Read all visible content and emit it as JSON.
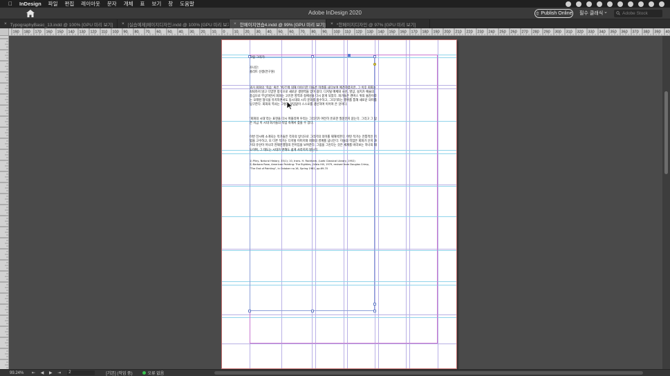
{
  "menubar": {
    "app_name": "InDesign",
    "items": [
      "파일",
      "편집",
      "레이아웃",
      "문자",
      "개체",
      "표",
      "보기",
      "창",
      "도움말"
    ]
  },
  "appbar": {
    "title": "Adobe InDesign 2020",
    "publish_label": "Publish Online",
    "workspace_label": "필수 클래식",
    "search_placeholder": "Adobe Stock"
  },
  "tabs": [
    {
      "label": "TypographyBasic_13.indd @ 100% [GPU 미리 보기]",
      "active": false
    },
    {
      "label": "[실습예제]페이지디자인.indd @ 100% [GPU 미리 보기]",
      "active": false
    },
    {
      "label": "한페이지연습4.indd @ 99% [GPU 미리 보기]",
      "active": true
    },
    {
      "label": "*한페이지디자인 @ 97% [GPU 미리 보기]",
      "active": false
    }
  ],
  "ruler": {
    "h_labels": [
      "190",
      "180",
      "170",
      "160",
      "150",
      "140",
      "130",
      "120",
      "110",
      "100",
      "90",
      "80",
      "70",
      "60",
      "50",
      "40",
      "30",
      "20",
      "10",
      "0",
      "10",
      "20",
      "30",
      "40",
      "50",
      "60",
      "70",
      "80",
      "90",
      "100",
      "110",
      "120",
      "130",
      "140",
      "150",
      "160",
      "170",
      "180",
      "190",
      "200",
      "210",
      "220",
      "230",
      "240",
      "250",
      "260",
      "270",
      "280",
      "290",
      "300",
      "310",
      "320",
      "330",
      "340",
      "350",
      "360",
      "370",
      "380",
      "390",
      "400"
    ]
  },
  "document": {
    "heading": "그림 그리기:",
    "subheading_1": "조나단:",
    "subheading_2": "플리트 선생(연구원)",
    "paragraph_1": "과거 회화의 ‘죽음’ 혹은 ‘위기’에 대해 이야기한 이들은 미래를 내다보며 예견하였지만, 그 이후 회화는 쇠퇴하지 않고 다양한 방식으로 새로운 생명력을 얻어 왔다. 디지털 매체와 사진, 영상, 설치가 예술의 중심으로 부상하면서 회화는 고유한 영역과 정체성을 다시 묻게 되었다. 화가들은 캔버스 위의 물감이라는 오래된 형식을 유지하면서도 동시대의 시각 문화를 흡수하고, 그리기라는 행위를 통해 새로운 의미를 탐구한다. 회화의 역사는 그렇게 끊임없이 스스로를 갱신하며 이어져 온 것이다.",
    "paragraph_2": "‘회화의 시대’라는 표현을 다시 떠올리며 우리는 그리기가 여전히 유효한 질문인지 묻는다. 그리고 그 답은 지금 이 시대 화가들의 작업 속에서 찾을 수 있다.",
    "paragraph_3": "이번 전시에 소개되는 작가들은 각자의 방식으로 그리기의 의미를 재해석한다. 어떤 작가는 전통적인 기법을 고수하고, 또 다른 작가는 디지털 이미지와 회화의 경계를 넘나든다. 이들의 작업은 회화가 단지 과거의 유산이 아니라 현재진행형의 언어임을 보여준다. 그림을 그린다는 것은 세계를 바라보는 하나의 태도이며, 그 태도는 시대가 변해도 쉽게 사라지지 않는다.",
    "footnote_1": "1) Pliny, Natural History, 35(1); 10, trans. H. Rackham, (Loeb Classical Library, 1952)",
    "footnote_2": "2) Barbara Rose, American Painting: The Eighties, (Vista Hill, 1979, revised from Douglas Crimp,",
    "footnote_3": "\"The End of Painting\", in October no.16, Spring 1981, pp.69-70"
  },
  "statusbar": {
    "zoom": "99.24%",
    "page_number": "2",
    "nav_glyphs": "⇤ ◀ ▶ ⇥",
    "preflight_profile": "[기본] (작업 중)",
    "errors_label": "오류 없음"
  }
}
